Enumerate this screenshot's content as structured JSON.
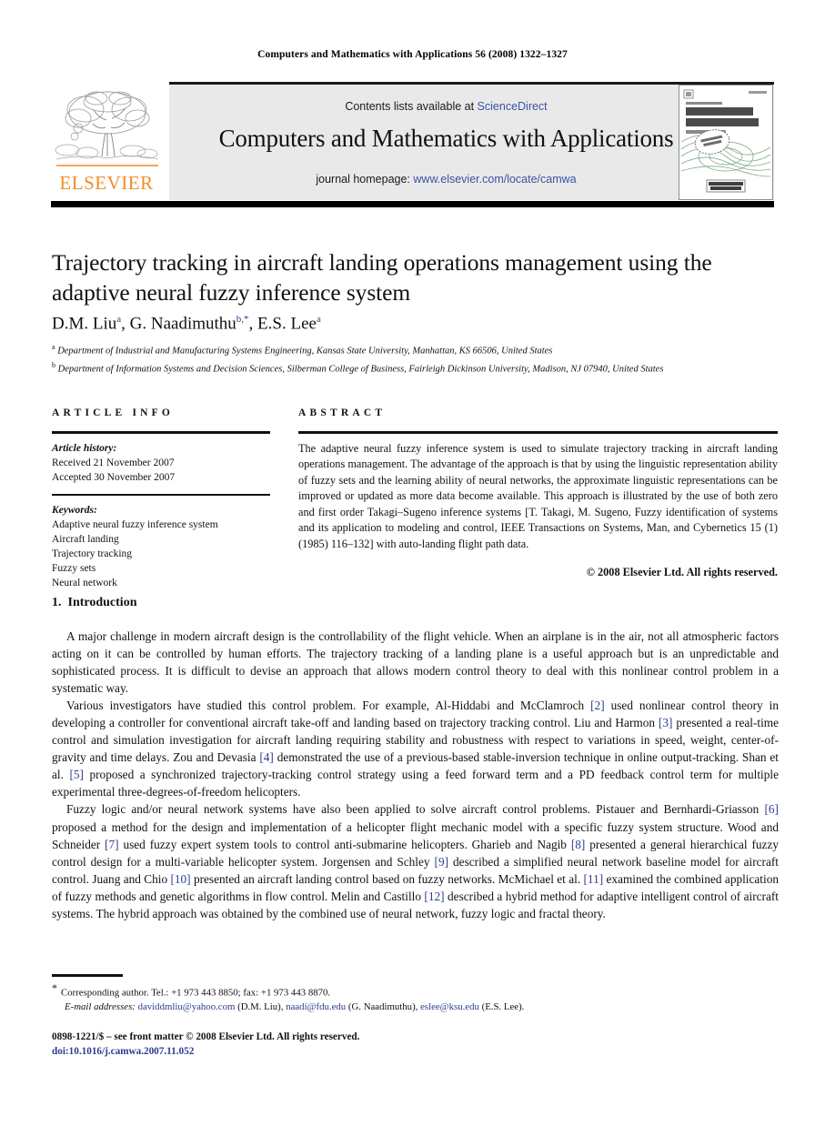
{
  "running_head": "Computers and Mathematics with Applications 56 (2008) 1322–1327",
  "masthead": {
    "contents_prefix": "Contents lists available at ",
    "sciencedirect": "ScienceDirect",
    "journal_title": "Computers and Mathematics with Applications",
    "homepage_prefix": "journal homepage: ",
    "homepage_url": "www.elsevier.com/locate/camwa",
    "publisher_wordmark": "ELSEVIER",
    "link_color": "#3a53a4",
    "band_color": "#e9e9e9",
    "publisher_color": "#f28c28"
  },
  "cover": {
    "kicker": "An International Journal",
    "line1": "computers &",
    "line2": "mathematics",
    "line3": "with applications",
    "issn": "ISSN 0898-1221",
    "badge": "ELECTRONIC ACCESS"
  },
  "title": "Trajectory tracking in aircraft landing operations management using the adaptive neural fuzzy inference system",
  "authors": {
    "a1": "D.M. Liu",
    "a1_sup": "a",
    "a2": "G. Naadimuthu",
    "a2_sup": "b,",
    "a2_star": "*",
    "a3": "E.S. Lee",
    "a3_sup": "a",
    "sep": ", "
  },
  "affiliations": [
    {
      "marker": "a",
      "text": "Department of Industrial and Manufacturing Systems Engineering, Kansas State University, Manhattan, KS 66506, United States"
    },
    {
      "marker": "b",
      "text": "Department of Information Systems and Decision Sciences, Silberman College of Business, Fairleigh Dickinson University, Madison, NJ 07940, United States"
    }
  ],
  "article_info": {
    "heading": "ARTICLE INFO",
    "history_label": "Article history:",
    "history": [
      "Received 21 November 2007",
      "Accepted 30 November 2007"
    ],
    "keywords_label": "Keywords:",
    "keywords": [
      "Adaptive neural fuzzy inference system",
      "Aircraft landing",
      "Trajectory tracking",
      "Fuzzy sets",
      "Neural network"
    ]
  },
  "abstract": {
    "heading": "ABSTRACT",
    "text": "The adaptive neural fuzzy inference system is used to simulate trajectory tracking in aircraft landing operations management. The advantage of the approach is that by using the linguistic representation ability of fuzzy sets and the learning ability of neural networks, the approximate linguistic representations can be improved or updated as more data become available. This approach is illustrated by the use of both zero and first order Takagi–Sugeno inference systems [T. Takagi, M. Sugeno, Fuzzy identification of systems and its application to modeling and control, IEEE Transactions on Systems, Man, and Cybernetics 15 (1) (1985) 116–132] with auto-landing flight path data.",
    "copyright": "© 2008 Elsevier Ltd. All rights reserved."
  },
  "section": {
    "number": "1.",
    "title": "Introduction"
  },
  "paragraphs": {
    "p1": "A major challenge in modern aircraft design is the controllability of the flight vehicle. When an airplane is in the air, not all atmospheric factors acting on it can be controlled by human efforts. The trajectory tracking of a landing plane is a useful approach but is an unpredictable and sophisticated process. It is difficult to devise an approach that allows modern control theory to deal with this nonlinear control problem in a systematic way.",
    "p2_a": "Various investigators have studied this control problem. For example, Al-Hiddabi and McClamroch ",
    "p2_r1": "[2]",
    "p2_b": " used nonlinear control theory in developing a controller for conventional aircraft take-off and landing based on trajectory tracking control. Liu and Harmon ",
    "p2_r2": "[3]",
    "p2_c": " presented a real-time control and simulation investigation for aircraft landing requiring stability and robustness with respect to variations in speed, weight, center-of-gravity and time delays. Zou and Devasia ",
    "p2_r3": "[4]",
    "p2_d": " demonstrated the use of a previous-based stable-inversion technique in online output-tracking. Shan et al. ",
    "p2_r4": "[5]",
    "p2_e": " proposed a synchronized trajectory-tracking control strategy using a feed forward term and a PD feedback control term for multiple experimental three-degrees-of-freedom helicopters.",
    "p3_a": "Fuzzy logic and/or neural network systems have also been applied to solve aircraft control problems. Pistauer and Bernhardi-Griasson ",
    "p3_r1": "[6]",
    "p3_b": " proposed a method for the design and implementation of a helicopter flight mechanic model with a specific fuzzy system structure. Wood and Schneider ",
    "p3_r2": "[7]",
    "p3_c": " used fuzzy expert system tools to control anti-submarine helicopters. Gharieb and Nagib ",
    "p3_r3": "[8]",
    "p3_d": " presented a general hierarchical fuzzy control design for a multi-variable helicopter system. Jorgensen and Schley ",
    "p3_r4": "[9]",
    "p3_e": " described a simplified neural network baseline model for aircraft control. Juang and Chio ",
    "p3_r5": "[10]",
    "p3_f": " presented an aircraft landing control based on fuzzy networks. McMichael et al. ",
    "p3_r6": "[11]",
    "p3_g": " examined the combined application of fuzzy methods and genetic algorithms in flow control. Melin and Castillo ",
    "p3_r7": "[12]",
    "p3_h": " described a hybrid method for adaptive intelligent control of aircraft systems. The hybrid approach was obtained by the combined use of neural network, fuzzy logic and fractal theory."
  },
  "footnotes": {
    "star": "*",
    "corresponding": "Corresponding author. Tel.: +1 973 443 8850; fax: +1 973 443 8870.",
    "email_label": "E-mail addresses:",
    "email1": "daviddmliu@yahoo.com",
    "email1_owner": "(D.M. Liu)",
    "email2": "naadi@fdu.edu",
    "email2_owner": "(G. Naadimuthu)",
    "email3": "eslee@ksu.edu",
    "email3_owner": "(E.S. Lee).",
    "sep": ", "
  },
  "imprint": {
    "front_matter": "0898-1221/$ – see front matter © 2008 Elsevier Ltd. All rights reserved.",
    "doi": "doi:10.1016/j.camwa.2007.11.052"
  }
}
